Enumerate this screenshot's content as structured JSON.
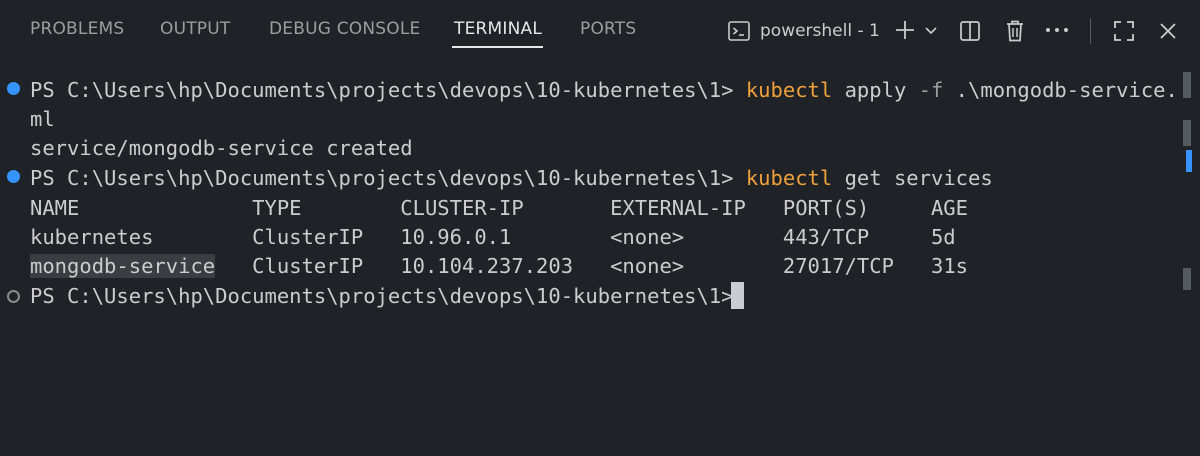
{
  "panel": {
    "tabs": [
      {
        "label": "PROBLEMS"
      },
      {
        "label": "OUTPUT"
      },
      {
        "label": "DEBUG CONSOLE"
      },
      {
        "label": "TERMINAL"
      },
      {
        "label": "PORTS"
      }
    ],
    "active_tab": "TERMINAL",
    "terminal_name": "powershell - 1",
    "icons": [
      "terminal-icon",
      "plus-icon",
      "chevron-down-icon",
      "split-icon",
      "trash-icon",
      "ellipsis-icon",
      "maximize-icon",
      "close-icon"
    ]
  },
  "terminal": {
    "prompt": "PS C:\\Users\\hp\\Documents\\projects\\devops\\10-kubernetes\\1> ",
    "lines": {
      "l1_cmd": "kubectl",
      "l1_args_a": " apply ",
      "l1_flag": "-f",
      "l1_args_b": " .\\mongodb-service.ya",
      "l2": "ml",
      "l3": "service/mongodb-service created",
      "l4_cmd": "kubectl",
      "l4_args": " get services",
      "header": "NAME              TYPE        CLUSTER-IP       EXTERNAL-IP   PORT(S)     AGE",
      "row1": "kubernetes        ClusterIP   10.96.0.1        <none>        443/TCP     5d",
      "row2_name": "mongodb-service",
      "row2_rest": "   ClusterIP   10.104.237.203   <none>        27017/TCP   31s"
    }
  },
  "colors": {
    "background": "#1f2328",
    "text": "#cccccc",
    "command": "#f0a03a",
    "decoration_success": "#3794ff",
    "active_tab": "#e7e7e7"
  }
}
